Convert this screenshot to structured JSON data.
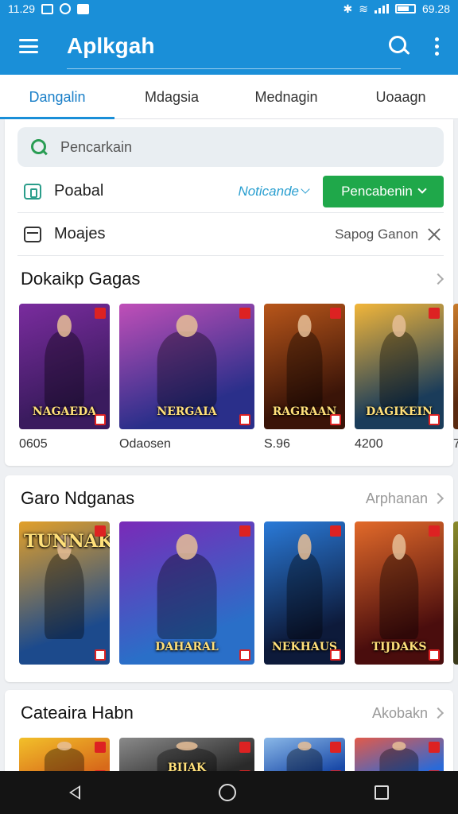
{
  "status_bar": {
    "time": "11.29",
    "battery_text": "69.28"
  },
  "app_bar": {
    "title": "Aplkgah",
    "icons": [
      "menu-icon",
      "search-icon",
      "more-vert-icon"
    ]
  },
  "tabs": [
    {
      "label": "Dangalin",
      "active": true
    },
    {
      "label": "Mdagsia",
      "active": false
    },
    {
      "label": "Mednagin",
      "active": false
    },
    {
      "label": "Uoaagn",
      "active": false
    }
  ],
  "search": {
    "placeholder": "Pencarkain",
    "value": ""
  },
  "filter_rows": [
    {
      "icon": "phone-icon",
      "label": "Poabal",
      "link": "Noticande",
      "button": "Pencabenin"
    },
    {
      "icon": "briefcase-icon",
      "label": "Moajes",
      "value": "Sapog Ganon"
    }
  ],
  "sections": [
    {
      "title": "Dokaikp Gagas",
      "more": "",
      "items": [
        {
          "logo": "NAGAEDA",
          "meta": "0605",
          "palette": [
            "#3a1b5e",
            "#7a2c9e"
          ]
        },
        {
          "logo": "NERGAIA",
          "meta": "Odaosen",
          "palette": [
            "#2a2f8a",
            "#c04fb8"
          ]
        },
        {
          "logo": "RAGRAAN",
          "meta": "S.96",
          "palette": [
            "#3a1408",
            "#b8561a"
          ]
        },
        {
          "logo": "DAGIKEIN",
          "meta": "4200",
          "palette": [
            "#1a3c5a",
            "#f2b63a"
          ]
        },
        {
          "logo": "",
          "meta": "7",
          "palette": [
            "#5a2a10",
            "#c87a2a"
          ]
        }
      ]
    },
    {
      "title": "Garo Ndganas",
      "more": "Arphanan",
      "items": [
        {
          "logo": "TUNNAK",
          "meta": "",
          "palette": [
            "#1c4a8c",
            "#e2a02a"
          ]
        },
        {
          "logo": "DAHARAL",
          "meta": "",
          "palette": [
            "#2a6fc8",
            "#7a2ab8"
          ]
        },
        {
          "logo": "NEKHAUS",
          "meta": "",
          "palette": [
            "#0d1a3a",
            "#2a7ad8"
          ]
        },
        {
          "logo": "TIJDAKS",
          "meta": "",
          "palette": [
            "#4a0d0d",
            "#e26a2a"
          ]
        },
        {
          "logo": "",
          "meta": "",
          "palette": [
            "#3a3a1a",
            "#8a8a2a"
          ]
        }
      ]
    },
    {
      "title": "Cateaira Habn",
      "more": "Akobakn",
      "items": [
        {
          "logo": "",
          "meta": "",
          "palette": [
            "#d86a1a",
            "#f2c02a"
          ]
        },
        {
          "logo": "BIJAK",
          "meta": "",
          "palette": [
            "#2a2a2a",
            "#8a8a8a"
          ]
        },
        {
          "logo": "",
          "meta": "",
          "palette": [
            "#1a4aa8",
            "#8ab8e8"
          ]
        },
        {
          "logo": "",
          "meta": "",
          "palette": [
            "#2a6ad8",
            "#e25a4a"
          ]
        }
      ]
    }
  ],
  "colors": {
    "accent": "#1a8fd8",
    "green_button": "#1fa84a"
  },
  "nav_bar": [
    "back-icon",
    "home-icon",
    "recents-icon"
  ]
}
